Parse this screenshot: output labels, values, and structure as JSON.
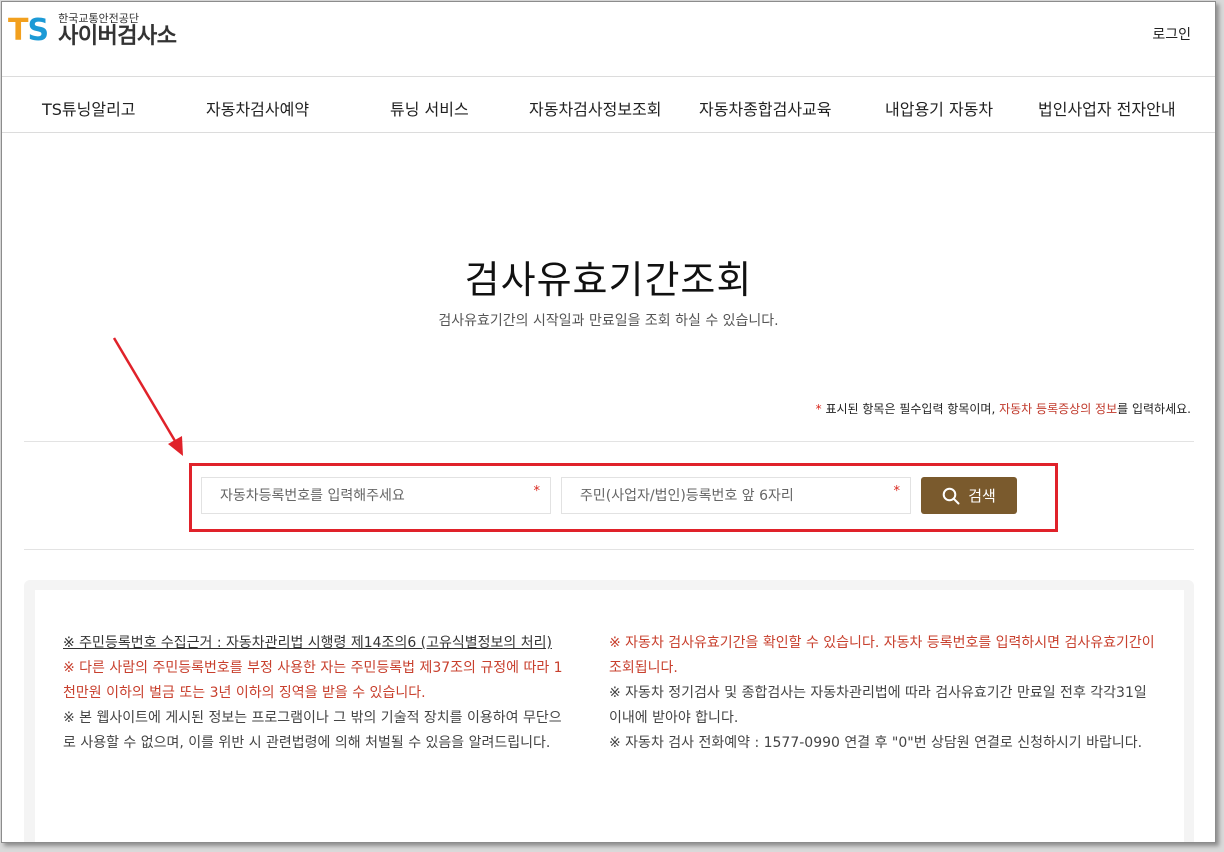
{
  "header": {
    "logo_mark_t": "T",
    "logo_mark_s": "S",
    "logo_subtitle": "한국교통안전공단",
    "logo_title": "사이버검사소",
    "login": "로그인"
  },
  "nav": {
    "items": [
      {
        "label": "TS튜닝알리고"
      },
      {
        "label": "자동차검사예약"
      },
      {
        "label": "튜닝 서비스"
      },
      {
        "label": "자동차검사정보조회"
      },
      {
        "label": "자동차종합검사교육"
      },
      {
        "label": "내압용기 자동차"
      },
      {
        "label": "법인사업자 전자안내"
      }
    ]
  },
  "main": {
    "title": "검사유효기간조회",
    "description": "검사유효기간의 시작일과 만료일을 조회 하실 수 있습니다.",
    "required_note": {
      "star": "*",
      "text1": " 표시된 항목은 필수입력 항목이며, ",
      "link": "자동차 등록증상의 정보",
      "text2": "를 입력하세요."
    },
    "search": {
      "car_number_placeholder": "자동차등록번호를 입력해주세요",
      "id_placeholder": "주민(사업자/법인)등록번호 앞 6자리",
      "required_star": "*",
      "button_label": "검색"
    }
  },
  "info": {
    "left": {
      "basis": "※ 주민등록번호 수집근거 : 자동차관리법 시행령 제14조의6 (고유식별정보의 처리)",
      "warning": "※ 다른 사람의 주민등록번호를 부정 사용한 자는 주민등록법 제37조의 규정에 따라 1천만원 이하의 벌금 또는 3년 이하의 징역을 받을 수 있습니다.",
      "notice": "※ 본 웹사이트에 게시된 정보는 프로그램이나 그 밖의 기술적 장치를 이용하여 무단으로 사용할 수 없으며, 이를 위반 시 관련법령에 의해 처벌될 수 있음을 알려드립니다."
    },
    "right": {
      "check": "※ 자동차 검사유효기간을 확인할 수 있습니다. 자동차 등록번호를 입력하시면 검사유효기간이 조회됩니다.",
      "periodic": "※ 자동차 정기검사 및 종합검사는 자동차관리법에 따라 검사유효기간 만료일 전후 각각31일 이내에 받아야 합니다.",
      "phone": "※ 자동차 검사 전화예약 : 1577-0990 연결 후 \"0\"번 상담원 연결로 신청하시기 바랍니다."
    }
  },
  "colors": {
    "accent_button": "#7a5a2d",
    "highlight_red": "#e0222a",
    "logo_orange": "#f2a01e",
    "logo_blue": "#1c9ad6"
  }
}
